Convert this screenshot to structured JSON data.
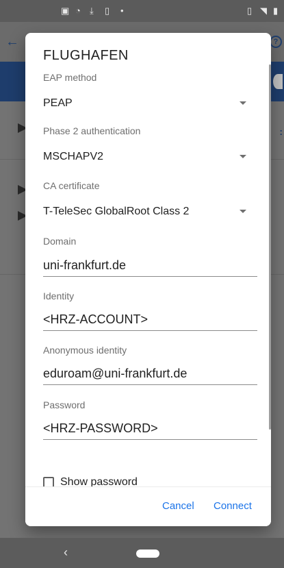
{
  "dialog": {
    "title": "FLUGHAFEN",
    "eap_method": {
      "label": "EAP method",
      "value": "PEAP"
    },
    "phase2": {
      "label": "Phase 2 authentication",
      "value": "MSCHAPV2"
    },
    "ca_certificate": {
      "label": "CA certificate",
      "value": "T-TeleSec GlobalRoot Class 2"
    },
    "domain": {
      "label": "Domain",
      "value": "uni-frankfurt.de"
    },
    "identity": {
      "label": "Identity",
      "value": "<HRZ-ACCOUNT>"
    },
    "anonymous_identity": {
      "label": "Anonymous identity",
      "value": "eduroam@uni-frankfurt.de"
    },
    "password": {
      "label": "Password",
      "value": "<HRZ-PASSWORD>"
    },
    "show_password": {
      "label": "Show password",
      "checked": false
    },
    "buttons": {
      "cancel": "Cancel",
      "connect": "Connect"
    }
  },
  "status_bar": {
    "icons": [
      "image-icon",
      "wifi-icon",
      "download-icon",
      "sim-icon",
      "dot-icon",
      "vibrate-icon",
      "signal-wifi-icon",
      "battery-icon"
    ]
  },
  "colors": {
    "accent": "#1a73e8",
    "banner": "#1e3d6c",
    "scrim": "#737373"
  }
}
